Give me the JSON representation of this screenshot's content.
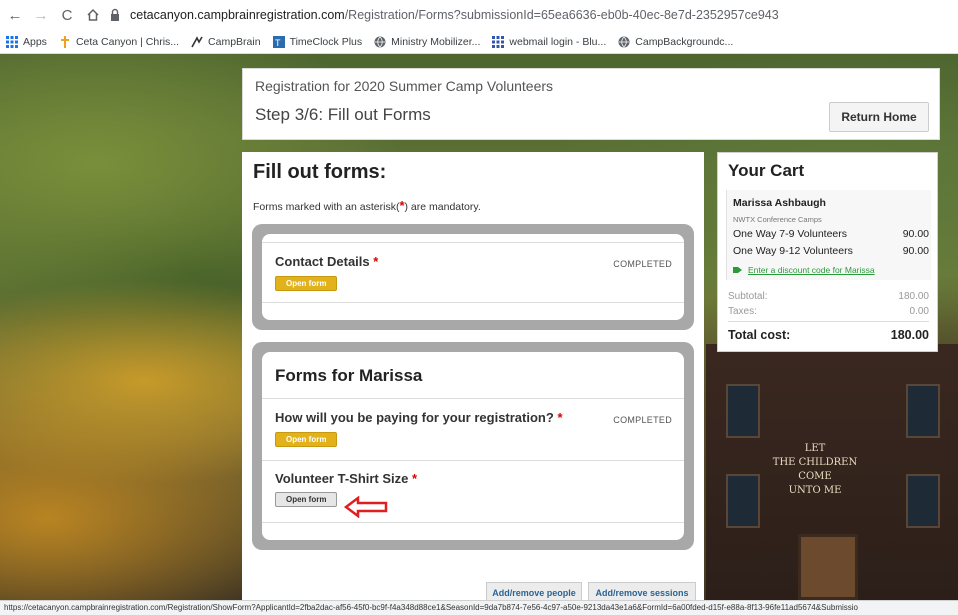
{
  "browser": {
    "url_host": "cetacanyon.campbrainregistration.com",
    "url_path": "/Registration/Forms?submissionId=65ea6636-eb0b-40ec-8e7d-2352957ce943",
    "bookmarks": [
      {
        "label": "Apps",
        "icon": "apps-grid-icon"
      },
      {
        "label": "Ceta Canyon | Chris...",
        "icon": "cross-icon"
      },
      {
        "label": "CampBrain",
        "icon": "campbrain-icon"
      },
      {
        "label": "TimeClock Plus",
        "icon": "timeclock-icon"
      },
      {
        "label": "Ministry Mobilizer...",
        "icon": "globe-icon"
      },
      {
        "label": "webmail login - Blu...",
        "icon": "apps-grid-icon"
      },
      {
        "label": "CampBackgroundc...",
        "icon": "globe-icon"
      }
    ],
    "status_url": "https://cetacanyon.campbrainregistration.com/Registration/ShowForm?ApplicantId=2fba2dac-af56-45f0-bc9f-f4a348d88ce1&SeasonId=9da7b874-7e56-4c97-a50e-9213da43e1a6&FormId=6a00fded-d15f-e88a-8f13-96fe11ad5674&Submissio"
  },
  "header": {
    "registration_title": "Registration for 2020 Summer Camp Volunteers",
    "step_title": "Step 3/6: Fill out Forms",
    "return_home": "Return Home"
  },
  "main": {
    "title": "Fill out forms:",
    "mandatory_prefix": "Forms marked with an asterisk(",
    "mandatory_ast": "*",
    "mandatory_suffix": ") are mandatory.",
    "contact_label": "Contact Details",
    "contact_status": "COMPLETED",
    "open_form": "Open form",
    "marissa_title": "Forms for Marissa",
    "paying_label": "How will you be paying for your registration?",
    "paying_status": "COMPLETED",
    "tshirt_label": "Volunteer T-Shirt Size",
    "req": "*",
    "add_people": "Add/remove people",
    "add_sessions": "Add/remove sessions"
  },
  "cart": {
    "title": "Your Cart",
    "name": "Marissa Ashbaugh",
    "camp": "NWTX Conference Camps",
    "items": [
      {
        "label": "One Way 7-9 Volunteers",
        "price": "90.00"
      },
      {
        "label": "One Way 9-12 Volunteers",
        "price": "90.00"
      }
    ],
    "discount": "Enter a discount code for Marissa",
    "subtotal_label": "Subtotal:",
    "subtotal": "180.00",
    "taxes_label": "Taxes:",
    "taxes": "0.00",
    "total_label": "Total cost:",
    "total": "180.00"
  },
  "background_text": [
    "LET",
    "THE CHILDREN",
    "COME",
    "UNTO ME"
  ]
}
